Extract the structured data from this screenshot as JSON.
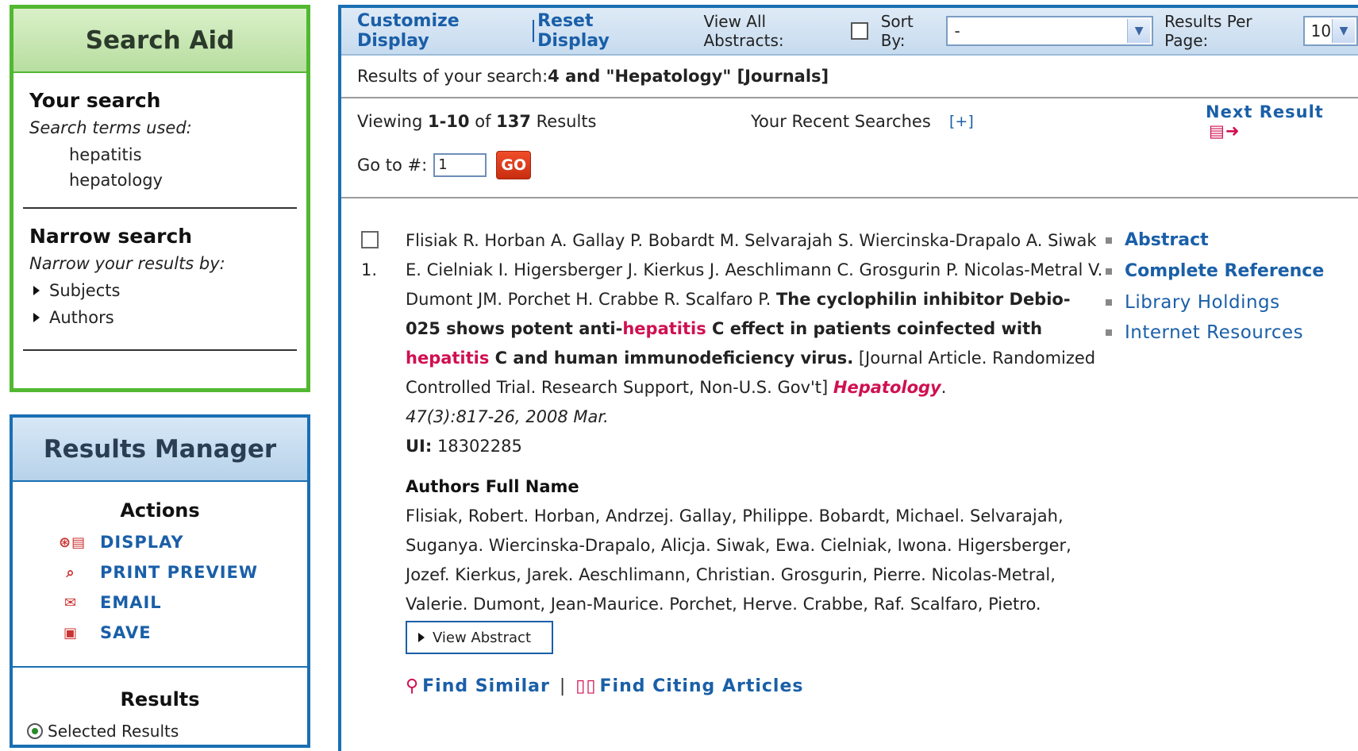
{
  "search_aid": {
    "title": "Search Aid",
    "your_search": "Your search",
    "terms_label": "Search terms used:",
    "terms": [
      "hepatitis",
      "hepatology"
    ],
    "narrow_title": "Narrow search",
    "narrow_label": "Narrow your results by:",
    "narrow_items": [
      "Subjects",
      "Authors"
    ]
  },
  "results_manager": {
    "title": "Results Manager",
    "actions_title": "Actions",
    "actions": [
      {
        "label": "DISPLAY",
        "icon": "display-icon"
      },
      {
        "label": "PRINT PREVIEW",
        "icon": "print-preview-icon"
      },
      {
        "label": "EMAIL",
        "icon": "email-icon"
      },
      {
        "label": "SAVE",
        "icon": "save-icon"
      }
    ],
    "results_title": "Results",
    "selected_results": "Selected Results"
  },
  "toolbar": {
    "customize": "Customize Display",
    "reset": "Reset Display",
    "view_all_abstracts": "View All Abstracts:",
    "sort_by_label": "Sort By:",
    "sort_by_value": "-",
    "per_page_label": "Results Per Page:",
    "per_page_value": "10"
  },
  "results_header": {
    "prefix": "Results of your search: ",
    "query": "4 and \"Hepatology\" [Journals]"
  },
  "viewing": {
    "prefix": "Viewing ",
    "range": "1-10",
    "of": " of ",
    "total": "137",
    "suffix": " Results",
    "recent_searches": "Your Recent Searches",
    "recent_toggle": "[+]",
    "next_result": "Next Result"
  },
  "goto": {
    "label": "Go to #:",
    "value": "1",
    "button": "GO"
  },
  "citation": {
    "number": "1.",
    "authors": "Flisiak R. Horban A. Gallay P. Bobardt M. Selvarajah S. Wiercinska-Drapalo A. Siwak E. Cielniak I. Higersberger J. Kierkus J. Aeschlimann C. Grosgurin P. Nicolas-Metral V. Dumont JM. Porchet H. Crabbe R. Scalfaro P.",
    "title_part1": "The cyclophilin inhibitor Debio-025 shows potent anti-",
    "title_hl1": "hepatitis",
    "title_part2": " C effect in patients coinfected with ",
    "title_hl2": "hepatitis",
    "title_part3": " C and human immunodeficiency virus.",
    "pub_type": " [Journal Article. Randomized Controlled Trial. Research Support, Non-U.S. Gov't] ",
    "journal": "Hepatology",
    "volume": "47(3):817-26, 2008 Mar.",
    "ui_label": "UI:",
    "ui_value": " 18302285",
    "authors_full_title": "Authors Full Name",
    "authors_full": "Flisiak, Robert. Horban, Andrzej. Gallay, Philippe. Bobardt, Michael. Selvarajah, Suganya. Wiercinska-Drapalo, Alicja. Siwak, Ewa. Cielniak, Iwona. Higersberger, Jozef. Kierkus, Jarek. Aeschlimann, Christian. Grosgurin, Pierre. Nicolas-Metral, Valerie. Dumont, Jean-Maurice. Porchet, Herve. Crabbe, Raf. Scalfaro, Pietro.",
    "view_abstract": "View Abstract",
    "find_similar": "Find Similar",
    "find_citing": "Find Citing Articles"
  },
  "side_links": {
    "abstract": "Abstract",
    "complete_reference": "Complete Reference",
    "library_holdings": "Library Holdings",
    "internet_resources": "Internet Resources"
  }
}
